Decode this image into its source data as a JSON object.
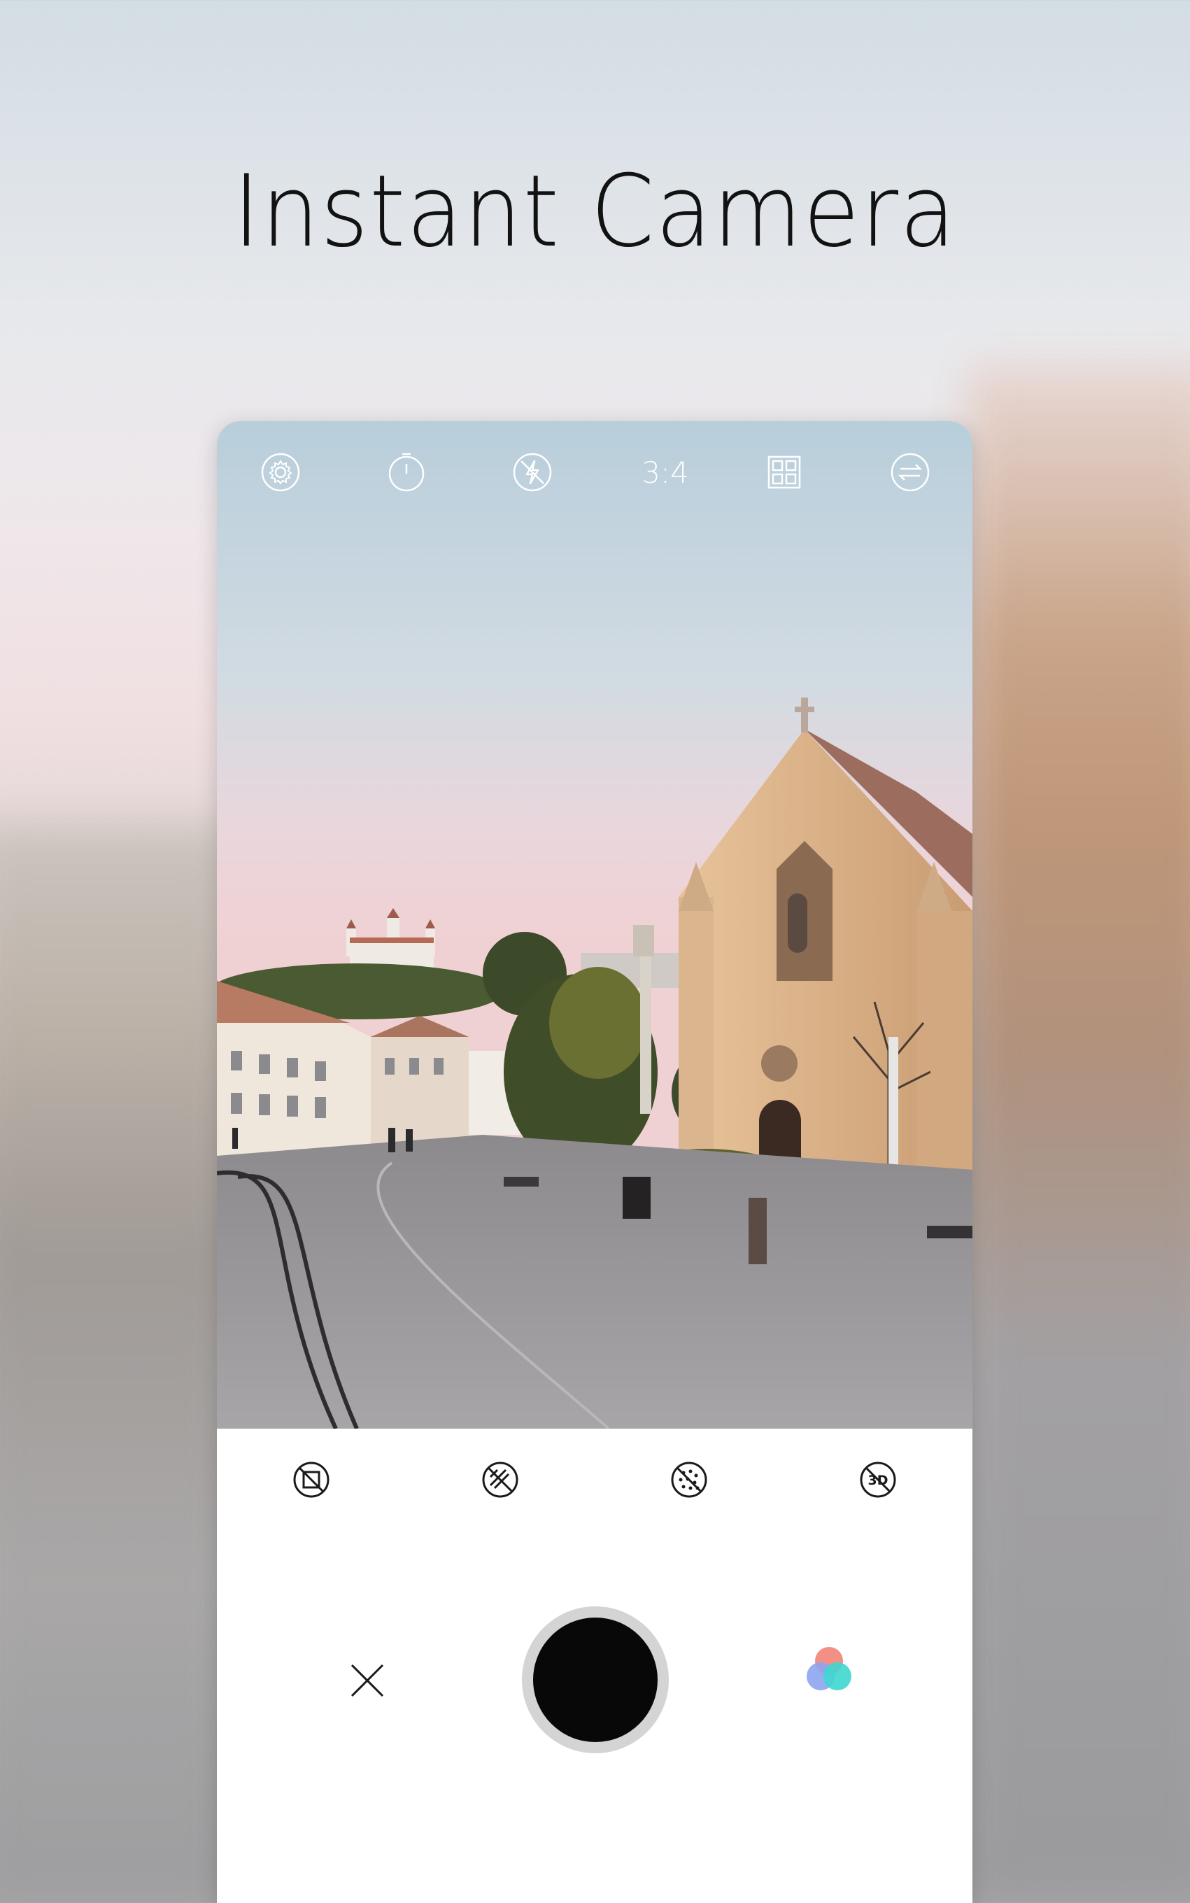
{
  "headline": "Instant Camera",
  "topbar": {
    "ratio_label": "3:4",
    "icons": [
      "settings-icon",
      "timer-icon",
      "flash-off-icon",
      "aspect-ratio",
      "grid-icon",
      "switch-camera-icon"
    ]
  },
  "toolstrip": {
    "icons": [
      "vignette-off-icon",
      "light-leak-off-icon",
      "grain-off-icon",
      "3d-off-icon"
    ],
    "badge_3d": "3D"
  },
  "controls": {
    "close_icon": "close-icon",
    "shutter": "shutter-button",
    "filters_icon": "filters-icon"
  },
  "colors": {
    "filter_red": "#f28a7e",
    "filter_blue": "#8ea4f0",
    "filter_teal": "#3fd7d0",
    "shutter_ring": "#d4d4d4",
    "shutter_core": "#080808"
  }
}
